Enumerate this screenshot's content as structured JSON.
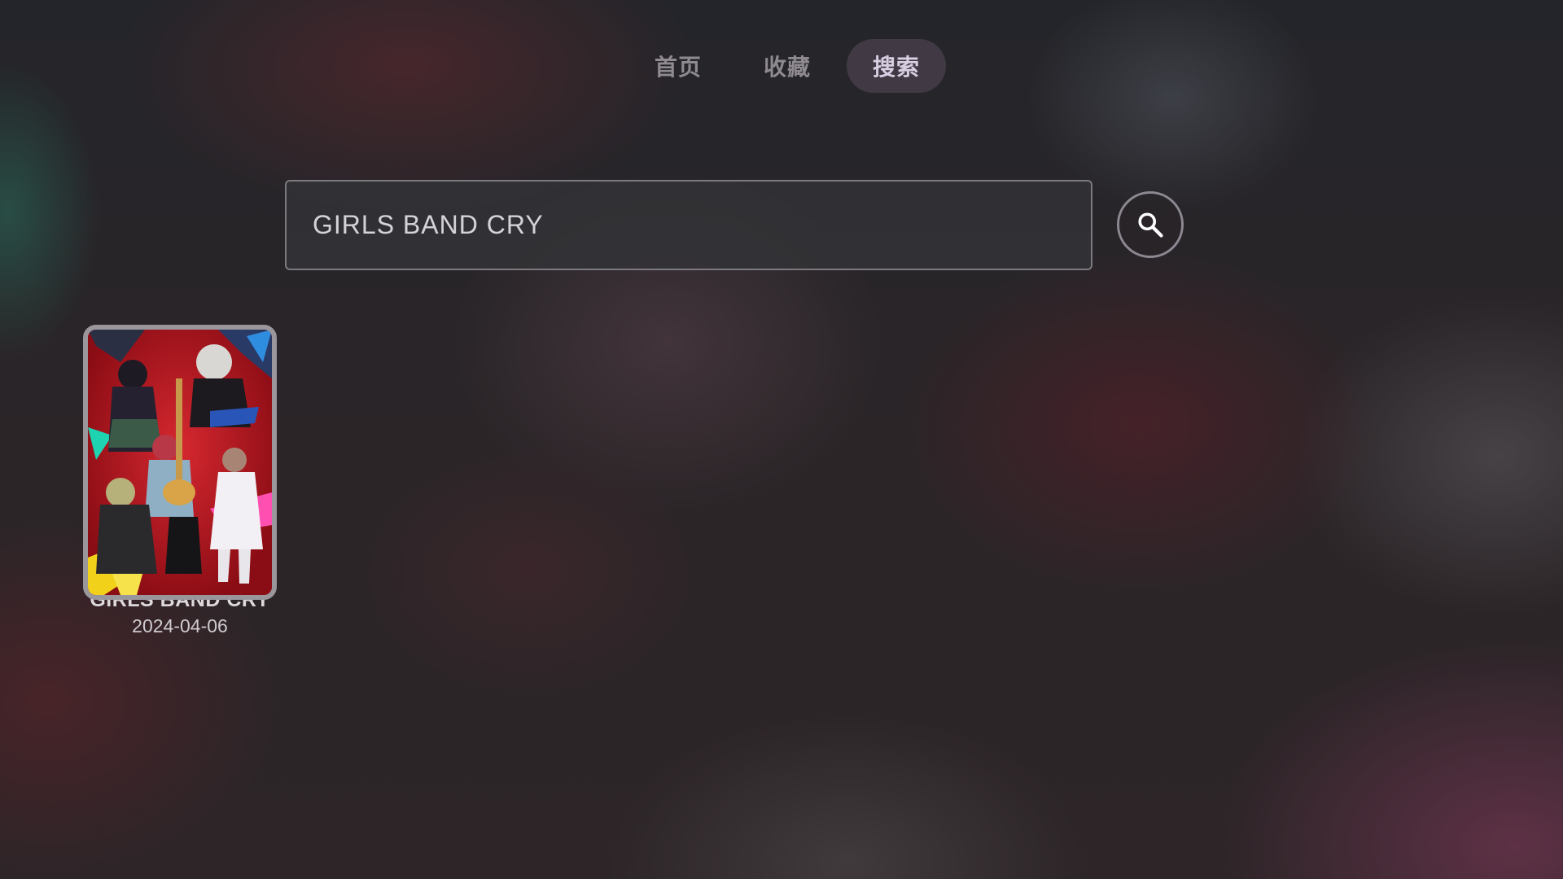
{
  "nav": {
    "tabs": [
      {
        "label": "首页",
        "active": false
      },
      {
        "label": "收藏",
        "active": false
      },
      {
        "label": "搜索",
        "active": true
      }
    ]
  },
  "search": {
    "query": "GIRLS BAND CRY",
    "button_icon": "search-icon"
  },
  "results": [
    {
      "title": "GIRLS BAND CRY",
      "date": "2024-04-06",
      "poster": "anime-key-visual"
    }
  ],
  "colors": {
    "active_tab_bg": "#463e4a",
    "poster_red": "#b3141e"
  }
}
